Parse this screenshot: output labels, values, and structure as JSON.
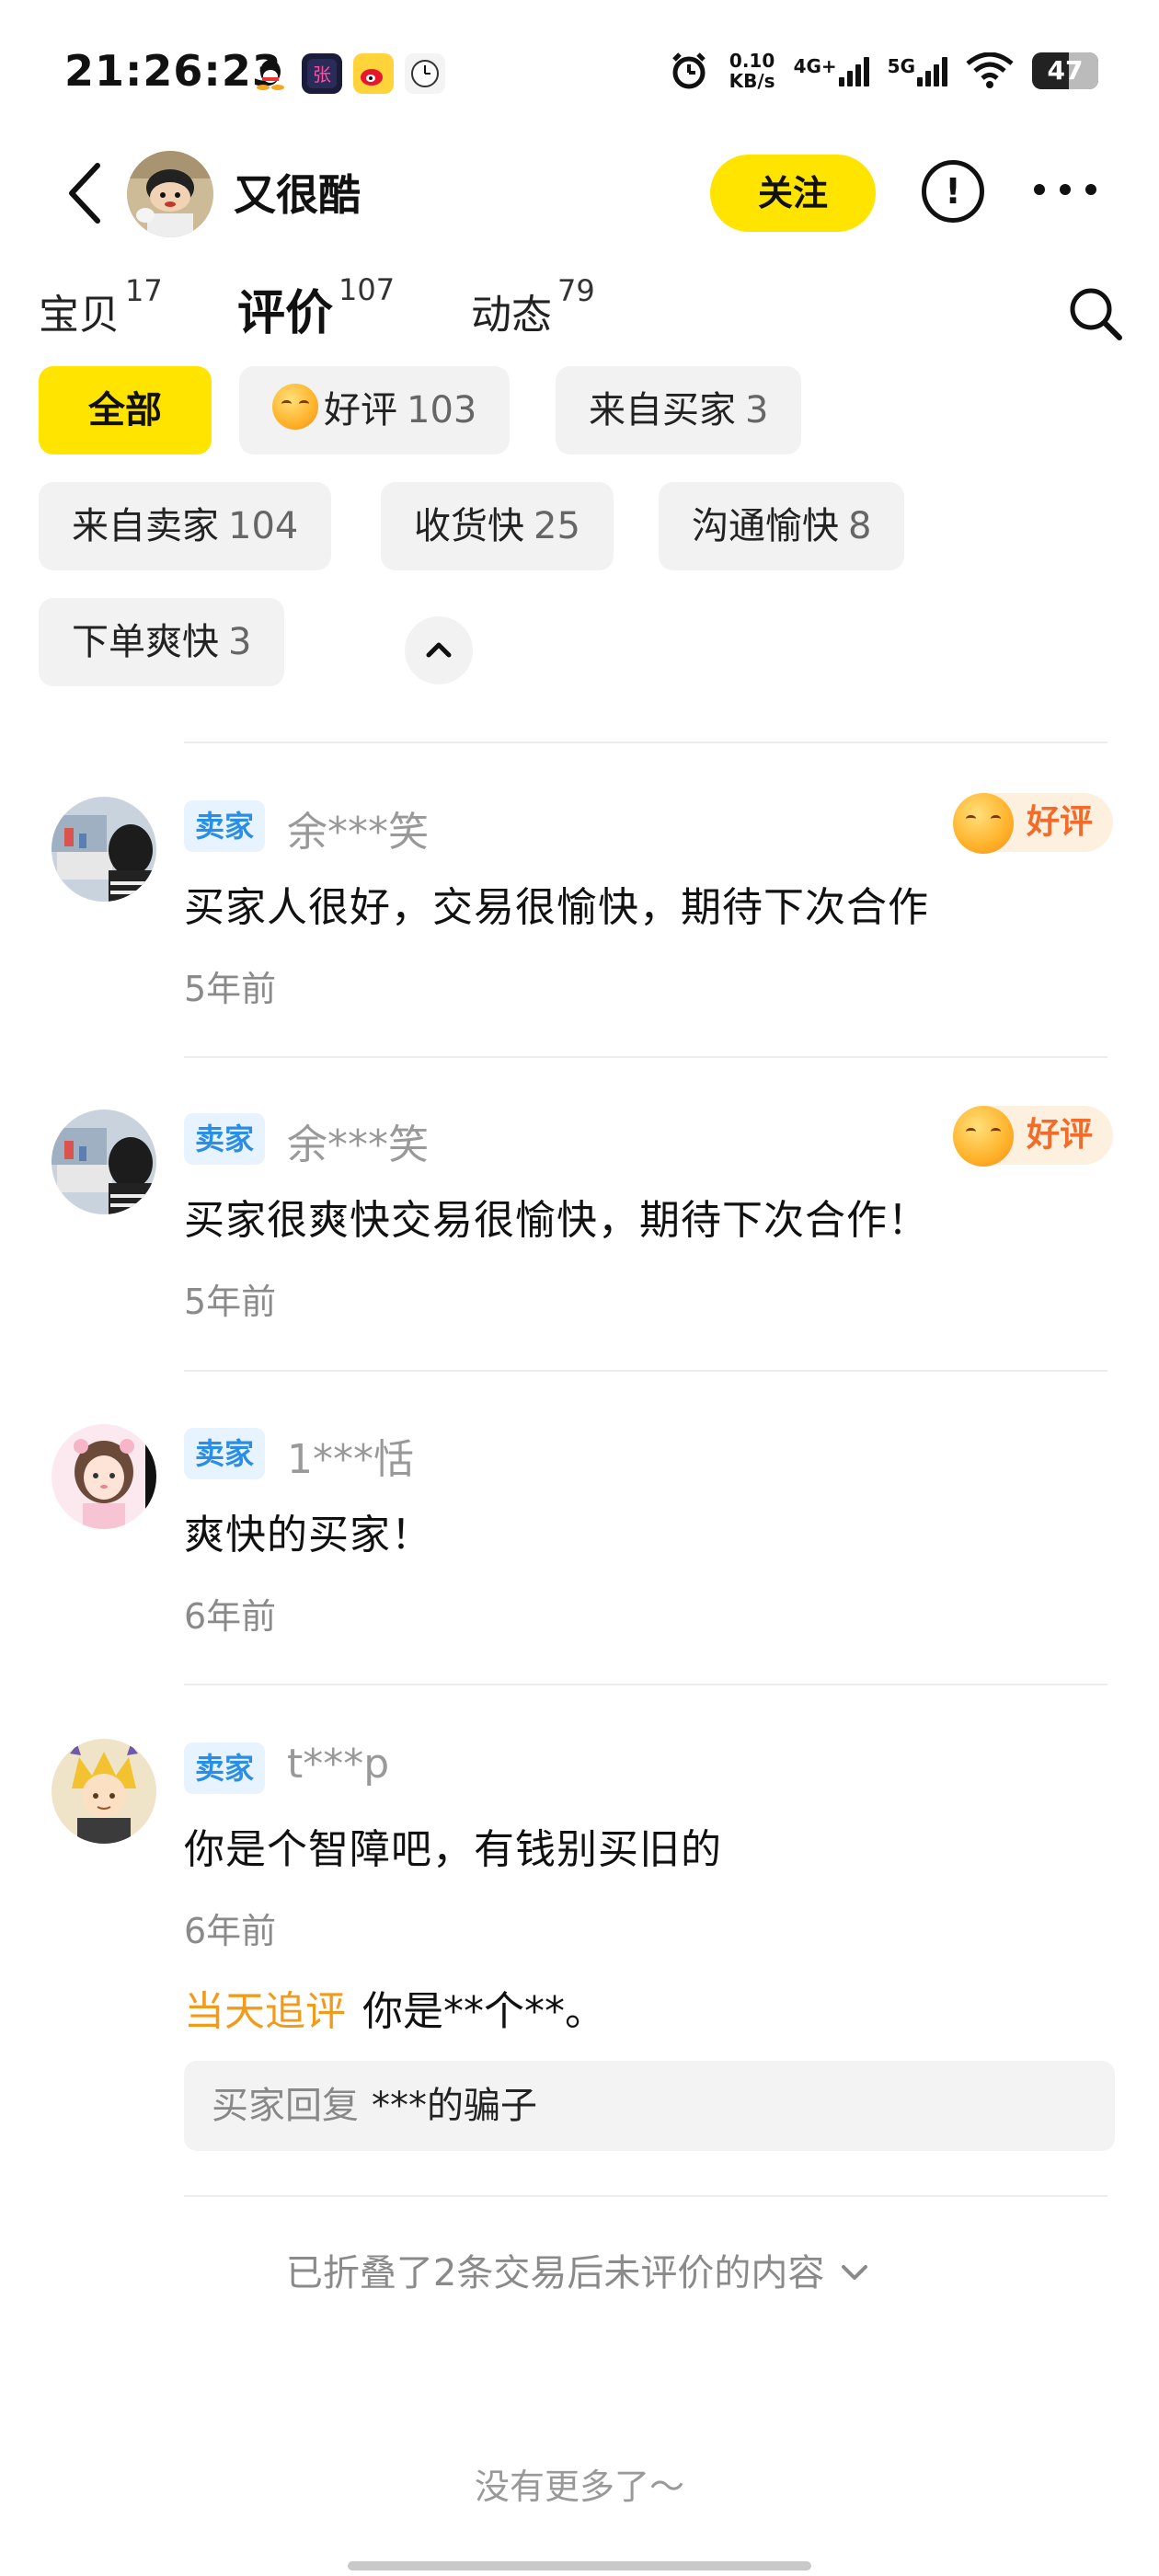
{
  "status_bar": {
    "time": "21:26:23",
    "app_icons": [
      "qq-icon",
      "app-icon",
      "weibo-icon",
      "clock-app-icon"
    ],
    "speed_value": "0.10",
    "speed_unit": "KB/s",
    "net1": "4G+",
    "net2": "5G",
    "battery": "47"
  },
  "header": {
    "shop_name": "又很酷",
    "follow_label": "关注",
    "report_symbol": "!"
  },
  "tabs": [
    {
      "label": "宝贝",
      "count": "17"
    },
    {
      "label": "评价",
      "count": "107"
    },
    {
      "label": "动态",
      "count": "79"
    }
  ],
  "filters": [
    {
      "label": "全部",
      "count": ""
    },
    {
      "label": "好评",
      "count": "103"
    },
    {
      "label": "来自买家",
      "count": "3"
    },
    {
      "label": "来自卖家",
      "count": "104"
    },
    {
      "label": "收货快",
      "count": "25"
    },
    {
      "label": "沟通愉快",
      "count": "8"
    },
    {
      "label": "下单爽快",
      "count": "3"
    }
  ],
  "reviews": [
    {
      "role": "卖家",
      "user": "余***笑",
      "badge": "好评",
      "text": "买家人很好，交易很愉快，期待下次合作",
      "time": "5年前"
    },
    {
      "role": "卖家",
      "user": "余***笑",
      "badge": "好评",
      "text": "买家很爽快交易很愉快，期待下次合作！",
      "time": "5年前"
    },
    {
      "role": "卖家",
      "user": "1***恬",
      "text": "爽快的买家！",
      "time": "6年前"
    },
    {
      "role": "卖家",
      "user": "t***p",
      "text": "你是个智障吧，有钱别买旧的",
      "time": "6年前",
      "followup_label": "当天追评",
      "followup_text": "你是**个**。",
      "reply_label": "买家回复",
      "reply_text": "***的骗子"
    }
  ],
  "folded_text": "已折叠了2条交易后未评价的内容",
  "no_more_text": "没有更多了～"
}
